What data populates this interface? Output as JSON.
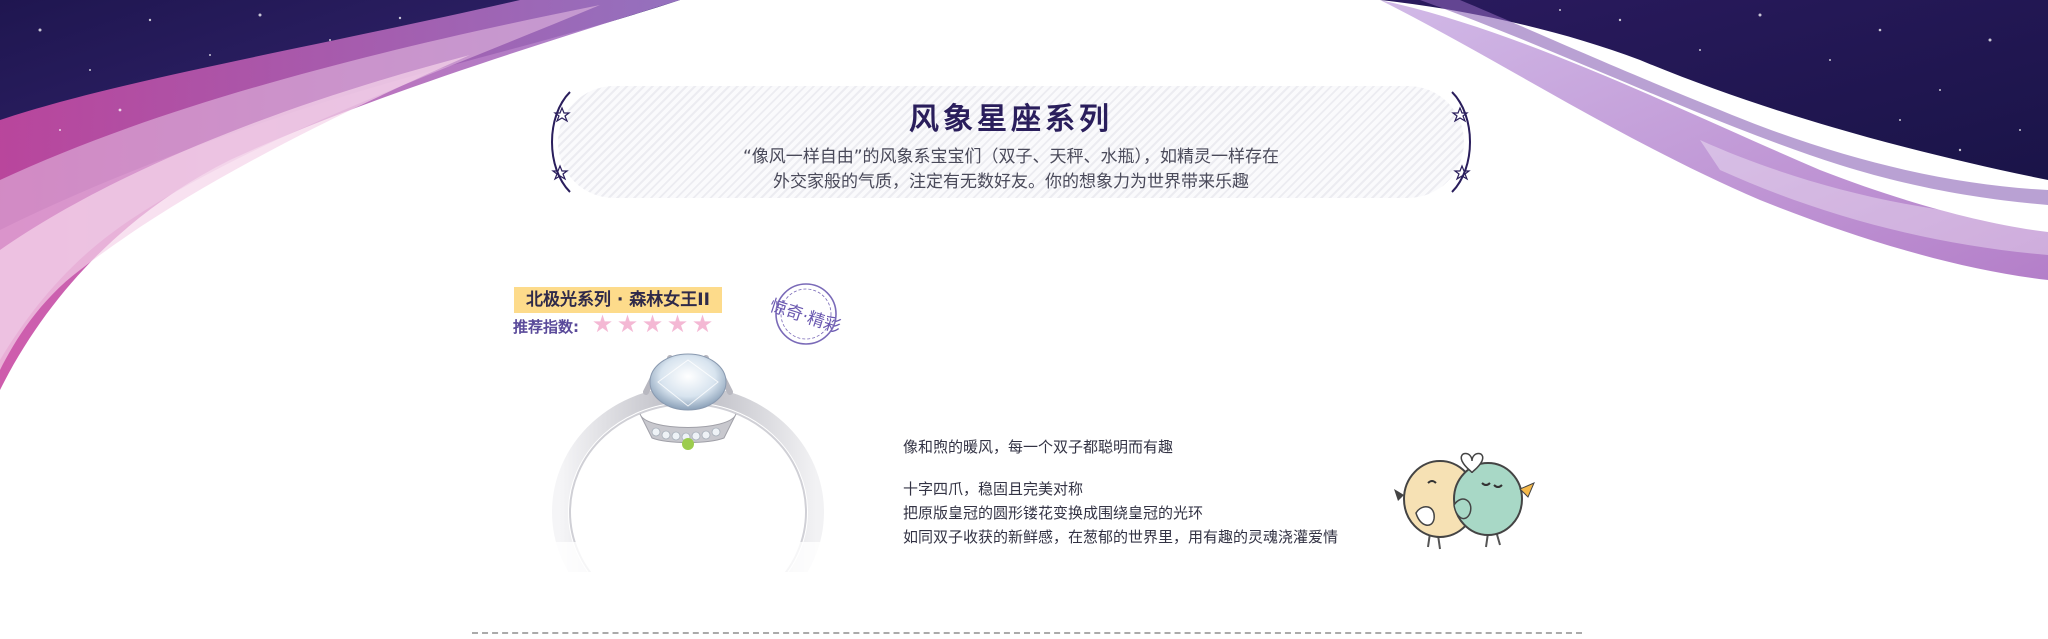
{
  "banner": {
    "title": "风象星座系列",
    "description_line1": "“像风一样自由”的风象系宝宝们（双子、天秤、水瓶），如精灵一样存在",
    "description_line2": "外交家般的气质，注定有无数好友。你的想象力为世界带来乐趣"
  },
  "product": {
    "tag": "北极光系列 · 森林女王II",
    "rating_label": "推荐指数:",
    "rating": 5,
    "rating_max": 5,
    "star_glyph": "★",
    "stamp_text": "惊奇·精彩"
  },
  "description": {
    "intro": "像和煦的暖风，每一个双子都聪明而有趣",
    "lines": [
      "十字四爪，稳固且完美对称",
      "把原版皇冠的圆形镂花变换成围绕皇冠的光环",
      "如同双子收获的新鲜感，在葱郁的世界里，用有趣的灵魂浇灌爱情"
    ]
  },
  "colors": {
    "night_sky": "#2a1a5e",
    "purple_wave": "#a478c8",
    "pink_wave": "#d35fb0",
    "banner_title": "#2a1e5c",
    "tag_bg": "#fddb8b",
    "star": "#f4b8d4"
  },
  "icons": [
    "star-icon",
    "ring-image",
    "love-birds-illustration",
    "stamp-seal"
  ]
}
